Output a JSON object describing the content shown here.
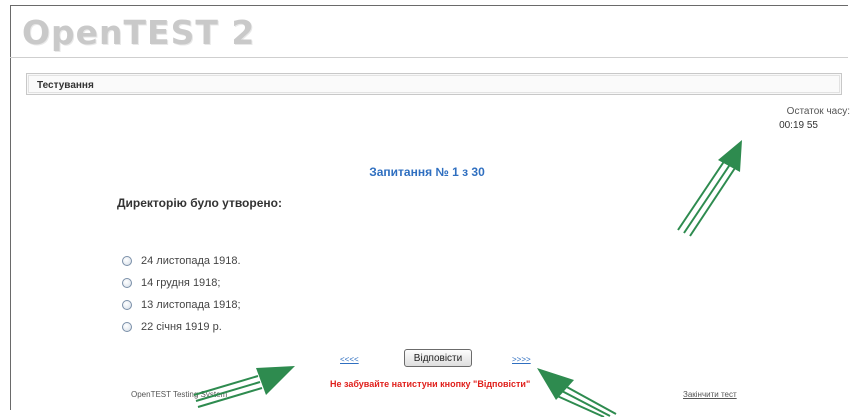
{
  "app": {
    "logo": "OpenTEST 2"
  },
  "tabbar": {
    "label": "Тестування"
  },
  "timer": {
    "label": "Остаток часу:",
    "value": "00:19 55"
  },
  "question": {
    "number_text": "Запитання № 1 з 30",
    "text": "Директорію було утворено:",
    "options": [
      {
        "label": "24 листопада 1918."
      },
      {
        "label": "14 грудня 1918;"
      },
      {
        "label": "13 листопада 1918;"
      },
      {
        "label": "22 січня 1919 р."
      }
    ]
  },
  "nav": {
    "prev": "<<<<",
    "next": ">>>>",
    "answer": "Відповісти"
  },
  "footer": {
    "system": "OpenTEST Testing System",
    "warning": "Не забувайте натистуни кнопку \"Відповісти\"",
    "finish": "Закінчити тест"
  },
  "colors": {
    "accent": "#2f6fc0",
    "warning": "#e0201c",
    "arrow": "#2e8b4f"
  }
}
